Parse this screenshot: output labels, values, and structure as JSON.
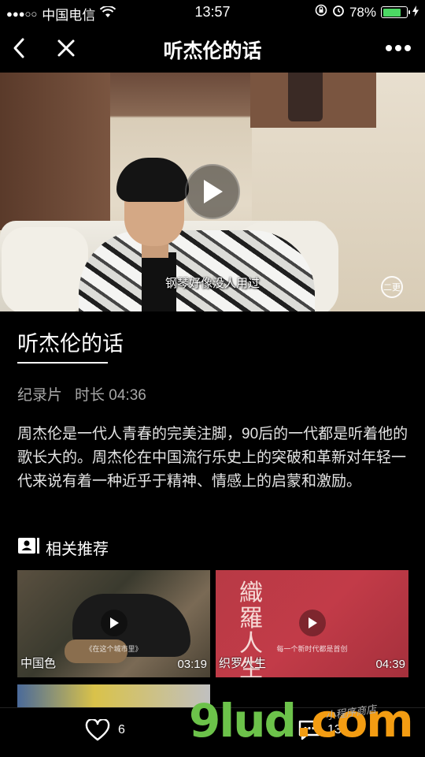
{
  "status_bar": {
    "signal": "●●●○○",
    "carrier": "中国电信",
    "time": "13:57",
    "battery_percent": "78%",
    "battery_level": 0.78
  },
  "nav": {
    "title": "听杰伦的话"
  },
  "video": {
    "subtitle": "钢琴好像没人用过",
    "logo_text": "二更"
  },
  "detail": {
    "title": "听杰伦的话",
    "category": "纪录片",
    "duration": "时长 04:36",
    "description": "周杰伦是一代人青春的完美注脚，90后的一代都是听着他的歌长大的。周杰伦在中国流行乐史上的突破和革新对年轻一代来说有着一种近乎于精神、情感上的启蒙和激励。"
  },
  "recommend": {
    "header": "相关推荐",
    "items": [
      {
        "name": "中国色",
        "duration": "03:19",
        "caption": "《在这个城市里》"
      },
      {
        "name": "织罗人生",
        "duration": "04:39",
        "caption": "每一个新时代都是首创",
        "calligraphy": "織羅人生"
      }
    ]
  },
  "bottom_bar": {
    "likes": "6",
    "comments": "13"
  },
  "watermark": {
    "brand": "9lud",
    "tld": ".com",
    "sub": "小程序商店"
  },
  "colors": {
    "background": "#000000",
    "battery": "#4cd964",
    "muted_text": "#a8a8a8"
  }
}
